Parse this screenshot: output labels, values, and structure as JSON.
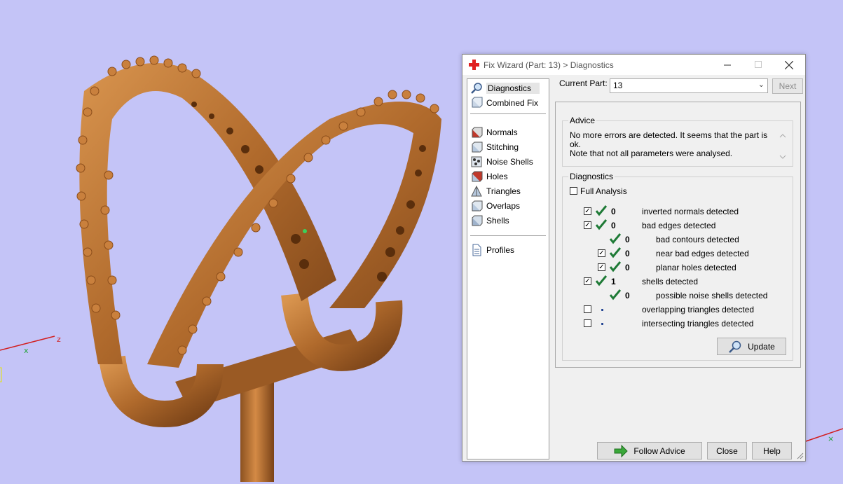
{
  "viewport": {
    "axis_x_label": "x",
    "axis_z_label": "z"
  },
  "dialog": {
    "title": "Fix Wizard (Part: 13) > Diagnostics",
    "nav_items": [
      "Diagnostics",
      "Combined Fix",
      "Normals",
      "Stitching",
      "Noise Shells",
      "Holes",
      "Triangles",
      "Overlaps",
      "Shells",
      "Profiles"
    ],
    "selected_nav": "Diagnostics",
    "current_part_label": "Current Part:",
    "current_part_value": "13",
    "next_label": "Next",
    "advice": {
      "title": "Advice",
      "line1": "No more errors are detected. It seems that the part is ok.",
      "line2": "Note that not all parameters were analysed."
    },
    "diagnostics": {
      "title": "Diagnostics",
      "full_analysis_label": "Full Analysis",
      "full_analysis_checked": false,
      "rows": [
        {
          "checked": true,
          "status": "ok",
          "count": "0",
          "label": "inverted normals detected"
        },
        {
          "checked": true,
          "status": "ok",
          "count": "0",
          "label": "bad edges detected"
        },
        {
          "checked": null,
          "status": "ok",
          "count": "0",
          "label": "bad contours detected"
        },
        {
          "checked": true,
          "status": "ok",
          "count": "0",
          "label": "near bad edges detected"
        },
        {
          "checked": true,
          "status": "ok",
          "count": "0",
          "label": "planar holes detected"
        },
        {
          "checked": true,
          "status": "ok",
          "count": "1",
          "label": "shells detected"
        },
        {
          "checked": null,
          "status": "ok",
          "count": "0",
          "label": "possible noise shells detected"
        },
        {
          "checked": false,
          "status": "none",
          "count": "",
          "label": "overlapping triangles detected"
        },
        {
          "checked": false,
          "status": "none",
          "count": "",
          "label": "intersecting triangles detected"
        }
      ],
      "update_label": "Update"
    },
    "footer": {
      "follow_advice_label": "Follow Advice",
      "close_label": "Close",
      "help_label": "Help"
    }
  },
  "colors": {
    "background": "#c4c4f7",
    "model": "#b87333",
    "check": "#1e7a36"
  }
}
